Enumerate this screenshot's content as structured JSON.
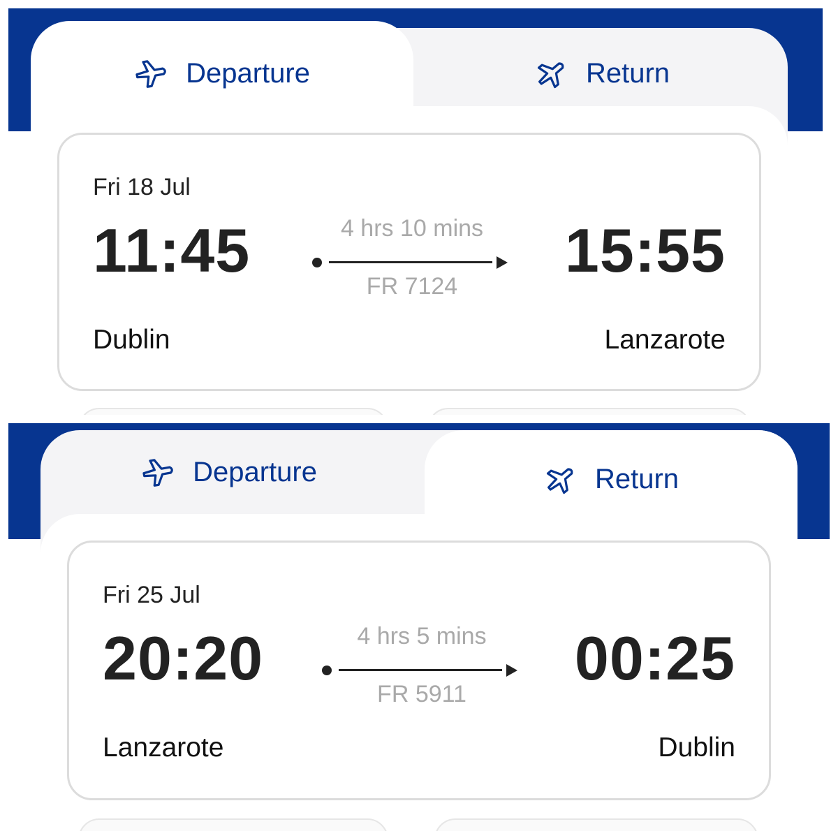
{
  "colors": {
    "brand_blue": "#073590",
    "text_dark": "#222222",
    "text_muted": "#a9a9a9",
    "card_border": "#dcdcdc"
  },
  "panels": [
    {
      "tabs": {
        "departure_label": "Departure",
        "return_label": "Return",
        "active": "departure",
        "icon": "plane-icon"
      },
      "flight": {
        "date": "Fri 18 Jul",
        "depart_time": "11:45",
        "arrive_time": "15:55",
        "duration": "4 hrs 10 mins",
        "flight_number": "FR 7124",
        "origin": "Dublin",
        "destination": "Lanzarote"
      }
    },
    {
      "tabs": {
        "departure_label": "Departure",
        "return_label": "Return",
        "active": "return",
        "icon": "plane-icon"
      },
      "flight": {
        "date": "Fri 25 Jul",
        "depart_time": "20:20",
        "arrive_time": "00:25",
        "duration": "4 hrs 5 mins",
        "flight_number": "FR 5911",
        "origin": "Lanzarote",
        "destination": "Dublin"
      }
    }
  ]
}
